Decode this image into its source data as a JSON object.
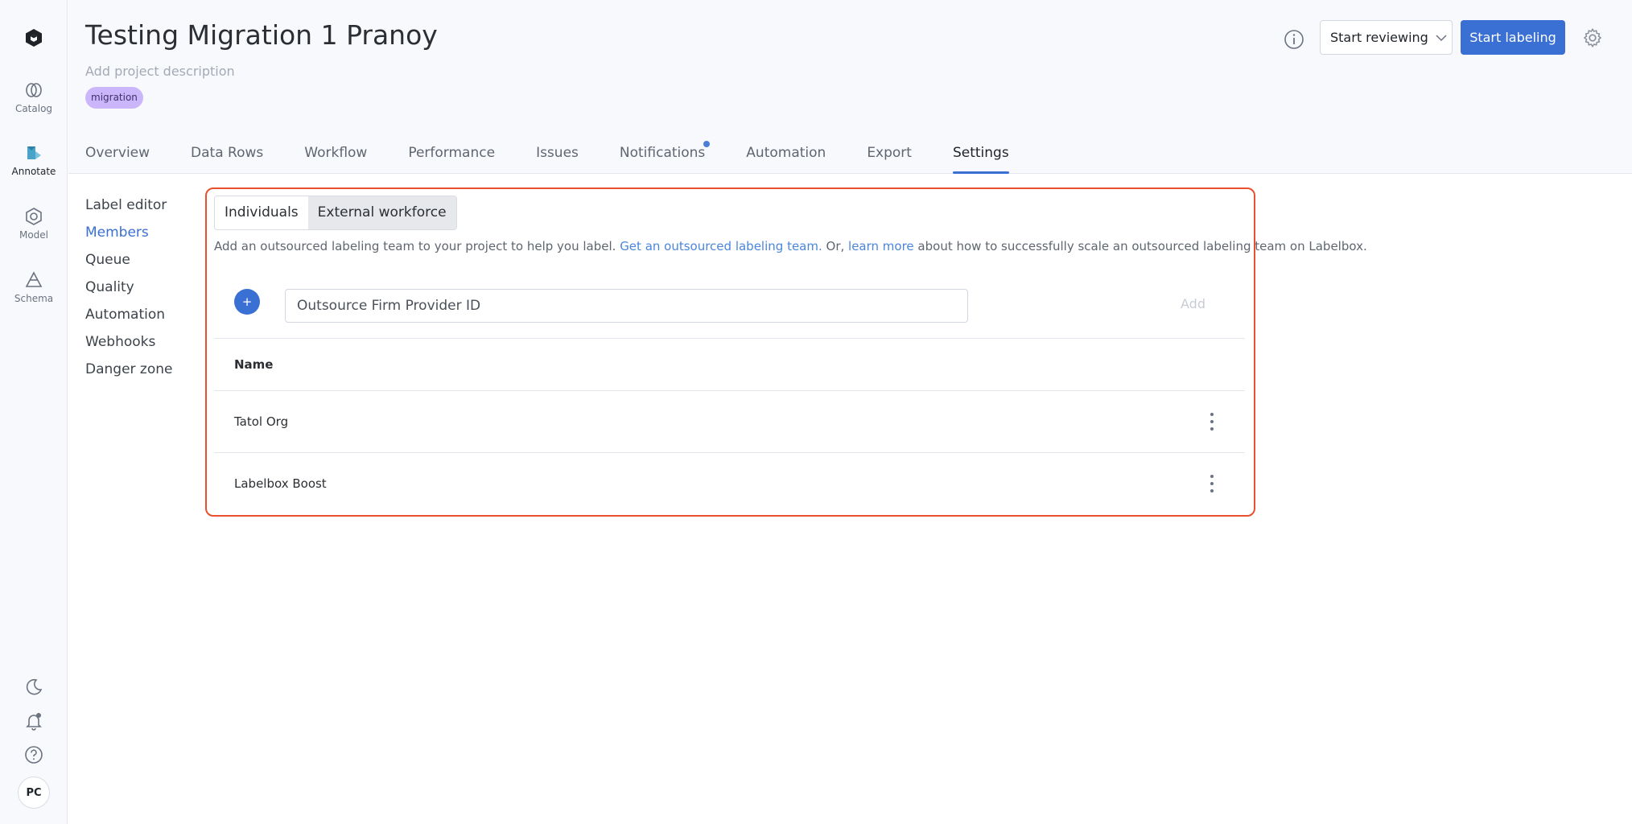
{
  "rail": {
    "items": [
      {
        "label": "Catalog",
        "icon": "catalog-icon"
      },
      {
        "label": "Annotate",
        "icon": "annotate-icon",
        "active": true
      },
      {
        "label": "Model",
        "icon": "model-icon"
      },
      {
        "label": "Schema",
        "icon": "schema-icon"
      }
    ],
    "avatar": "PC"
  },
  "header": {
    "title": "Testing Migration 1 Pranoy",
    "description_placeholder": "Add project description",
    "tag": "migration",
    "review_button": "Start reviewing",
    "label_button": "Start labeling"
  },
  "tabs": [
    {
      "label": "Overview"
    },
    {
      "label": "Data Rows"
    },
    {
      "label": "Workflow"
    },
    {
      "label": "Performance"
    },
    {
      "label": "Issues"
    },
    {
      "label": "Notifications",
      "has_dot": true
    },
    {
      "label": "Automation"
    },
    {
      "label": "Export"
    },
    {
      "label": "Settings",
      "active": true
    }
  ],
  "settings_nav": [
    {
      "label": "Label editor"
    },
    {
      "label": "Members",
      "active": true
    },
    {
      "label": "Queue"
    },
    {
      "label": "Quality"
    },
    {
      "label": "Automation"
    },
    {
      "label": "Webhooks"
    },
    {
      "label": "Danger zone"
    }
  ],
  "members": {
    "segments": {
      "individuals": "Individuals",
      "external": "External workforce"
    },
    "help": {
      "before": "Add an outsourced labeling team to your project to help you label. ",
      "link1": "Get an outsourced labeling team.",
      "middle": " Or, ",
      "link2": "learn more",
      "after": " about how to successfully scale an outsourced labeling team on Labelbox."
    },
    "plus_label": "+",
    "input_placeholder": "Outsource Firm Provider ID",
    "add_button": "Add",
    "table": {
      "header": "Name",
      "rows": [
        {
          "name": "Tatol Org"
        },
        {
          "name": "Labelbox Boost"
        }
      ]
    }
  },
  "colors": {
    "accent": "#3a6fd3",
    "highlight_border": "#e8502f",
    "tag_bg": "#cbb6fb"
  }
}
